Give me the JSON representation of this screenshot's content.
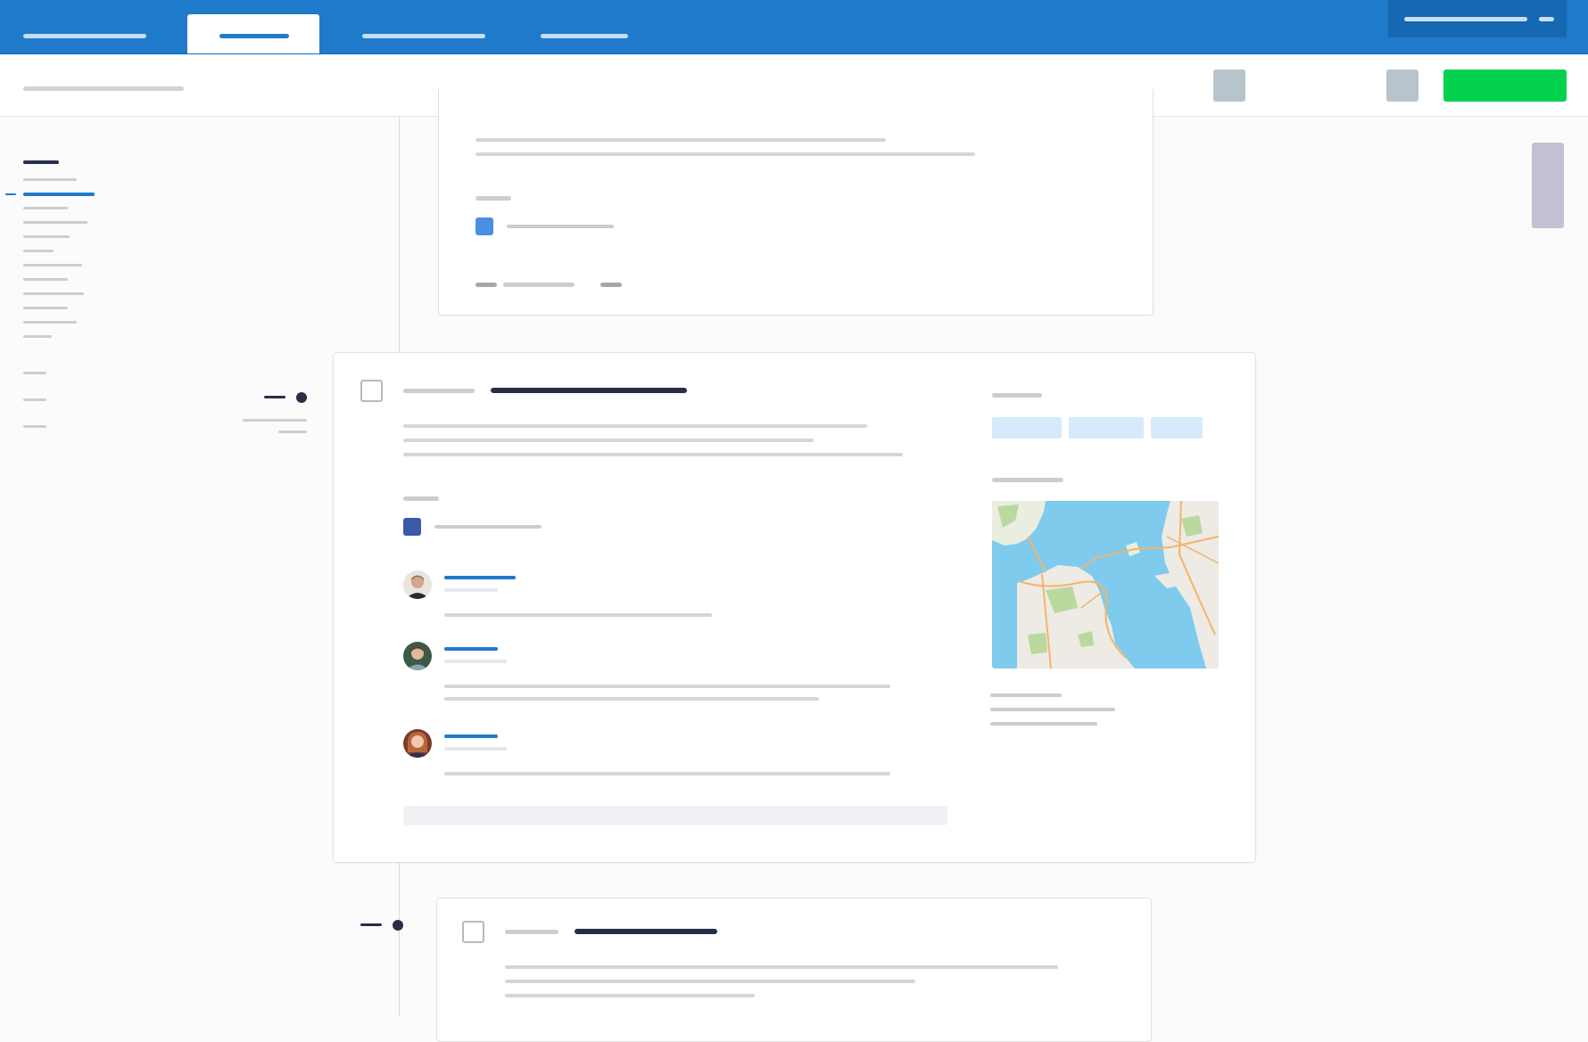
{
  "colors": {
    "header_blue": "#1f7acb",
    "accent_green": "#02d24e",
    "scrollbar": "#c3c2d2",
    "text_dark": "#282d48",
    "link_blue": "#1f7acb",
    "placeholder_gray": "#d4d6d9"
  },
  "icons": {
    "checkbox": "checkbox-icon",
    "color_swatch": "color-swatch-icon",
    "timeline_marker": "dot-icon",
    "map": "map-thumbnail"
  },
  "note": ""
}
